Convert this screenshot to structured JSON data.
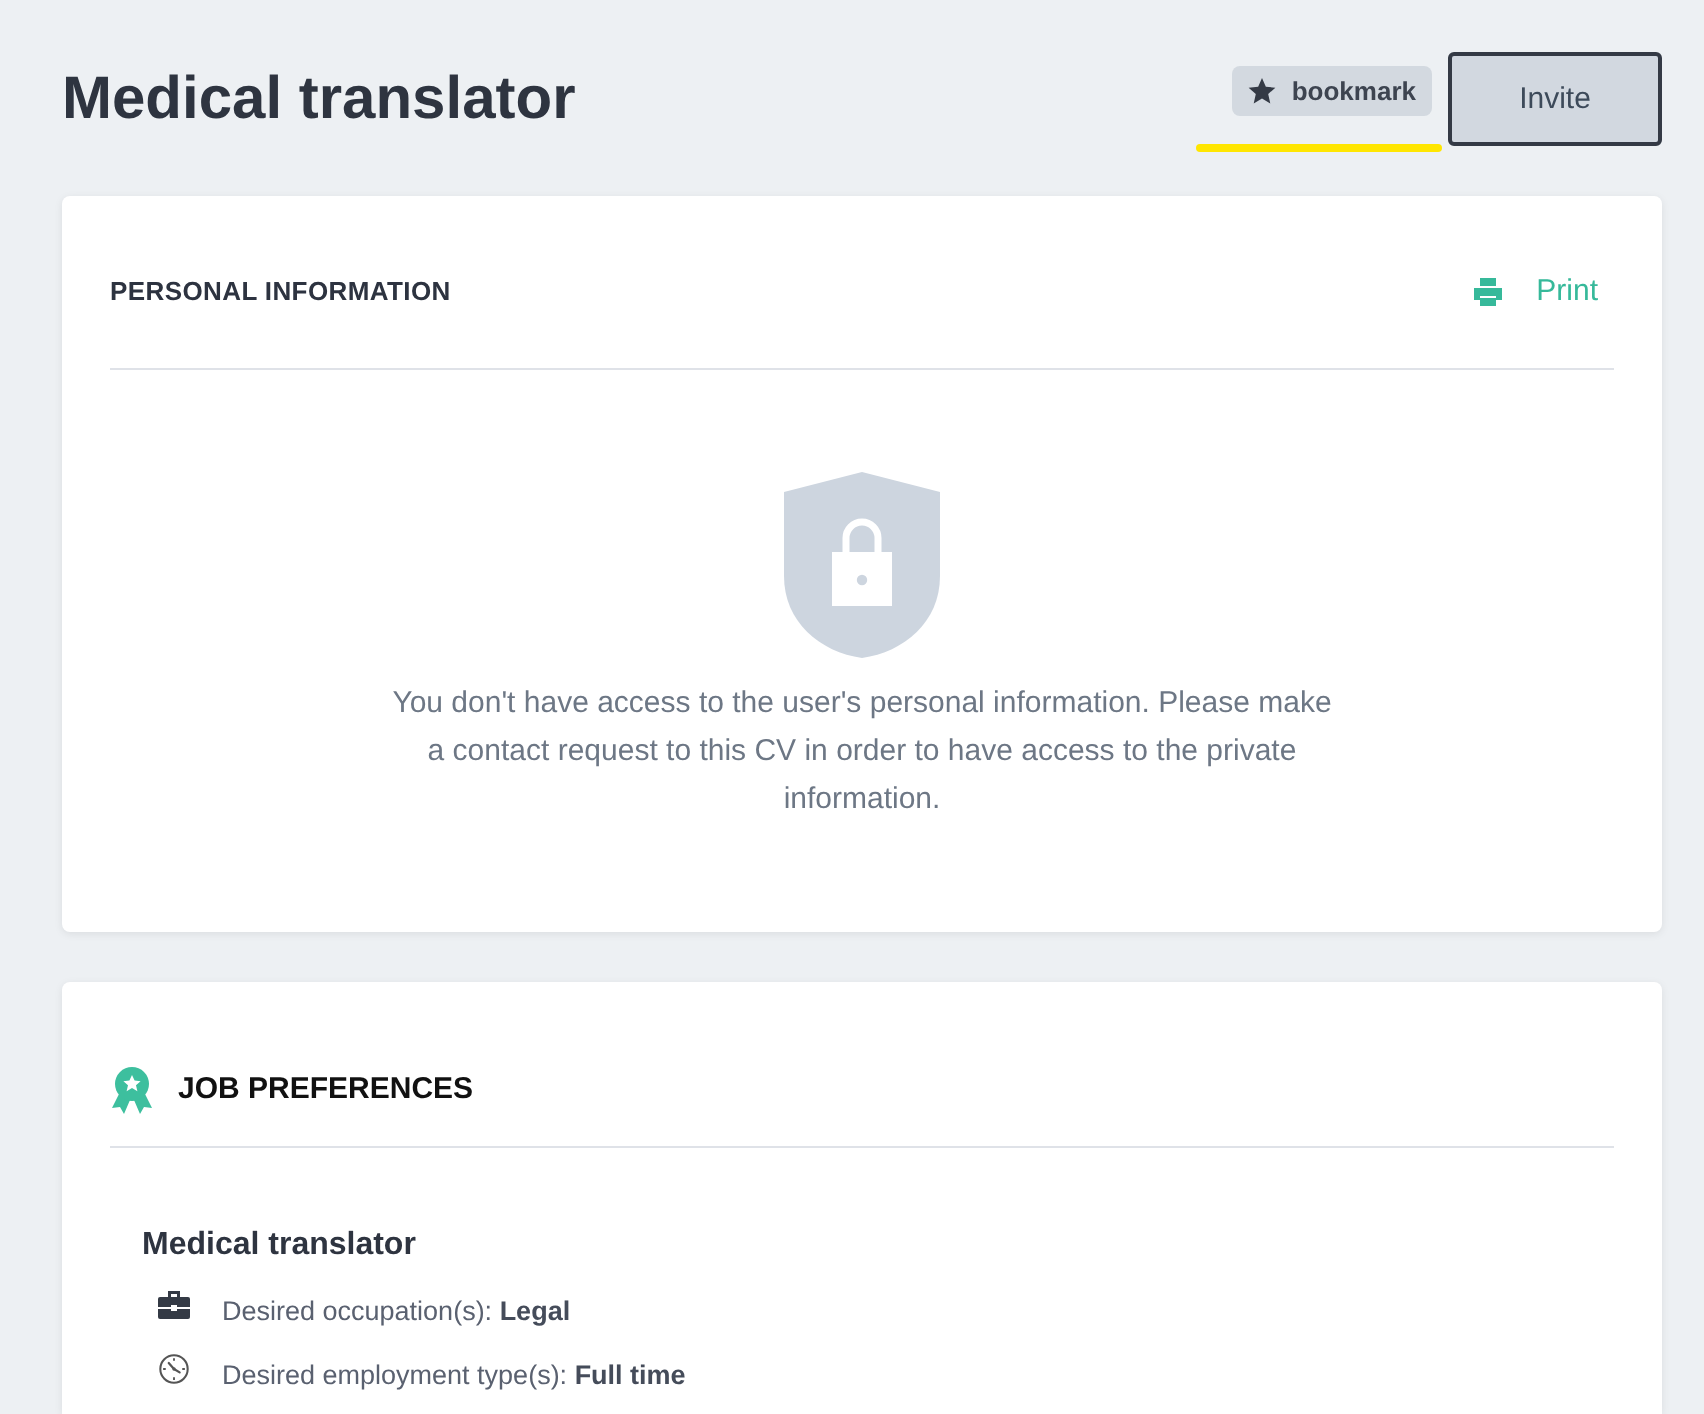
{
  "header": {
    "title": "Medical translator",
    "bookmark_button": {
      "label": "bookmark"
    },
    "invite_button": {
      "label": "Invite"
    }
  },
  "personal_information": {
    "title": "PERSONAL INFORMATION",
    "print_link": "Print",
    "message": "You don't have access to the user's personal information. Please make a contact request to this CV in order to have access to the private information."
  },
  "job_preferences": {
    "title": "JOB PREFERENCES",
    "position": "Medical translator",
    "details": [
      {
        "kind": "occupation",
        "text": "Desired occupation(s): **Legal**"
      },
      {
        "kind": "employment_type",
        "text": "Desired employment type(s): **Full time**"
      }
    ]
  }
}
